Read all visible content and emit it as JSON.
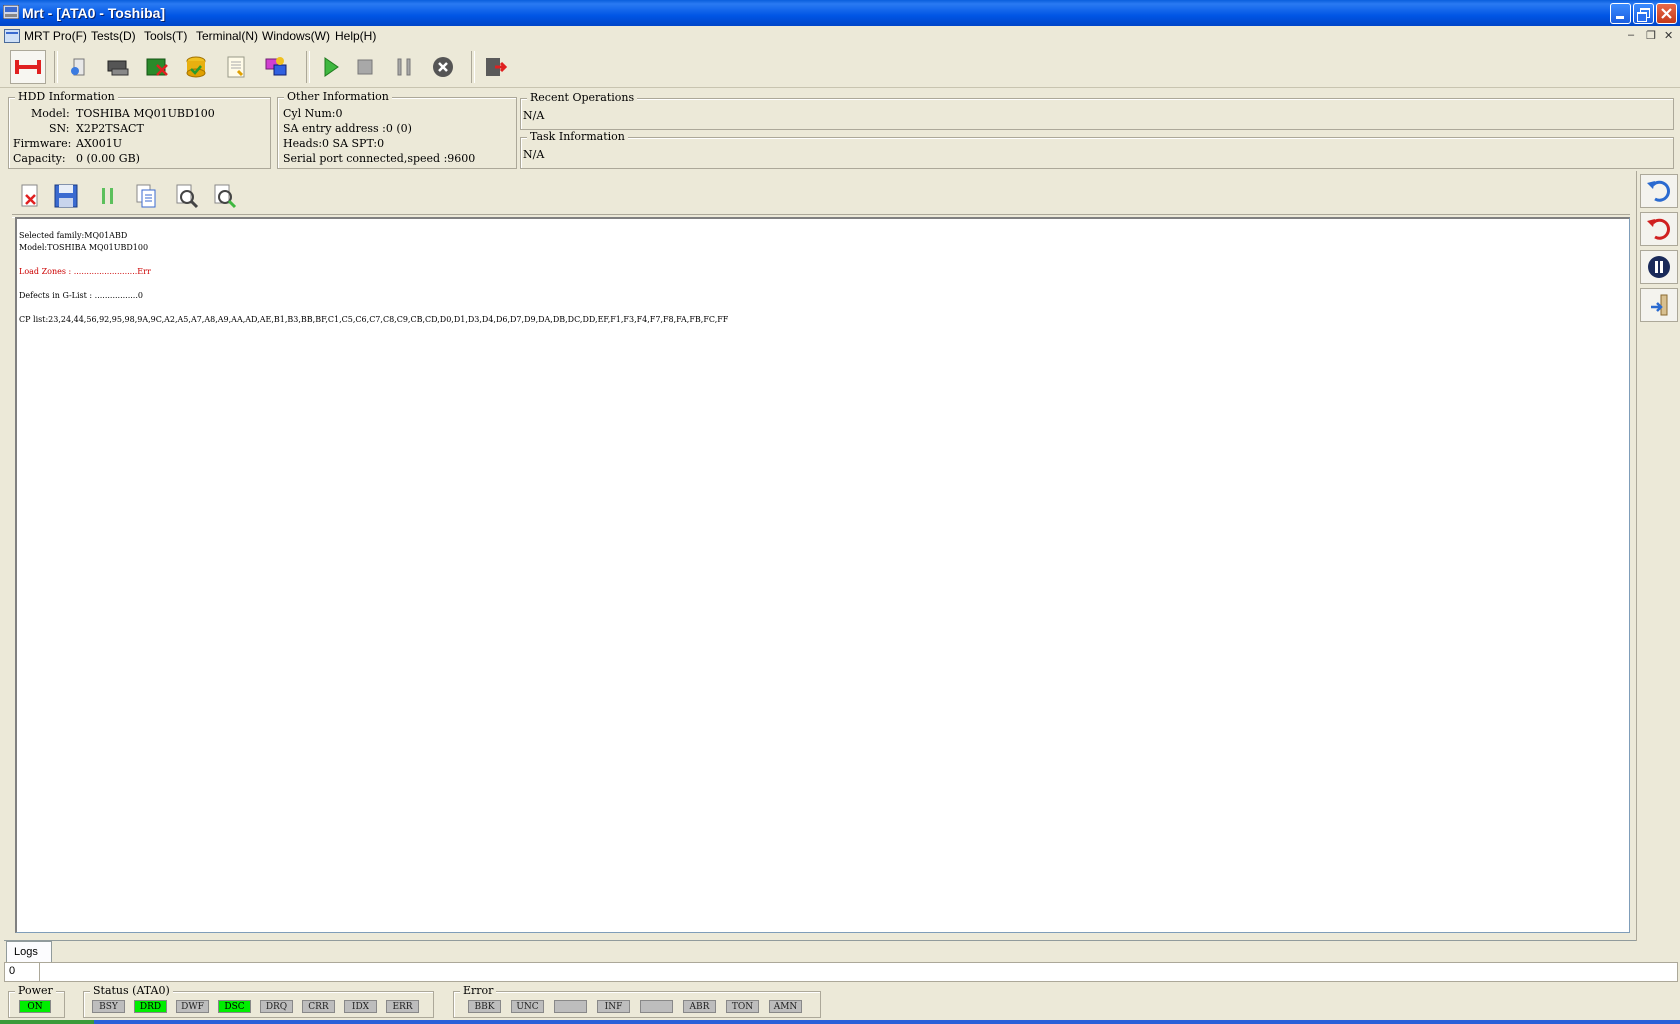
{
  "window": {
    "title": "Mrt - [ATA0 - Toshiba]"
  },
  "menu": {
    "items": [
      "MRT Pro(F)",
      "Tests(D)",
      "Tools(T)",
      "Terminal(N)",
      "Windows(W)",
      "Help(H)"
    ]
  },
  "hdd_info": {
    "legend": "HDD Information",
    "model_label": "Model:",
    "model": "TOSHIBA MQ01UBD100",
    "sn_label": "SN:",
    "sn": "X2P2TSACT",
    "firmware_label": "Firmware:",
    "firmware": "AX001U",
    "capacity_label": "Capacity:",
    "capacity": "0 (0.00 GB)"
  },
  "other_info": {
    "legend": "Other Information",
    "lines": [
      "Cyl Num:0",
      "SA entry address :0 (0)",
      "Heads:0 SA SPT:0",
      "Serial port connected,speed :9600"
    ]
  },
  "recent_ops": {
    "legend": "Recent Operations",
    "value": "N/A"
  },
  "task_info": {
    "legend": "Task Information",
    "value": "N/A"
  },
  "log": {
    "lines": [
      {
        "text": "Selected family:MQ01ABD",
        "color": "#000000"
      },
      {
        "text": "Model:TOSHIBA MQ01UBD100",
        "color": "#000000"
      },
      {
        "text": "",
        "color": "#000000"
      },
      {
        "text": "Load Zones : .........................Err",
        "color": "#cc0000"
      },
      {
        "text": "",
        "color": "#000000"
      },
      {
        "text": "Defects in G-List : .................0",
        "color": "#000000"
      },
      {
        "text": "",
        "color": "#000000"
      },
      {
        "text": "CP list:23,24,44,56,92,95,98,9A,9C,A2,A5,A7,A8,A9,AA,AD,AE,B1,B3,BB,BF,C1,C5,C6,C7,C8,C9,CB,CD,D0,D1,D3,D4,D6,D7,D9,DA,DB,DC,DD,EF,F1,F3,F4,F7,F8,FA,FB,FC,FF",
        "color": "#000000"
      }
    ]
  },
  "tabs": {
    "logs": "Logs"
  },
  "status_strip": {
    "value": "0"
  },
  "power": {
    "legend": "Power",
    "on_label": "ON"
  },
  "status": {
    "legend": "Status (ATA0)",
    "leds": [
      {
        "label": "BSY",
        "on": false
      },
      {
        "label": "DRD",
        "on": true
      },
      {
        "label": "DWF",
        "on": false
      },
      {
        "label": "DSC",
        "on": true
      },
      {
        "label": "DRQ",
        "on": false
      },
      {
        "label": "CRR",
        "on": false
      },
      {
        "label": "IDX",
        "on": false
      },
      {
        "label": "ERR",
        "on": false
      }
    ]
  },
  "error": {
    "legend": "Error",
    "leds": [
      {
        "label": "BBK",
        "on": false
      },
      {
        "label": "UNC",
        "on": false
      },
      {
        "label": "",
        "on": false
      },
      {
        "label": "INF",
        "on": false
      },
      {
        "label": "",
        "on": false
      },
      {
        "label": "ABR",
        "on": false
      },
      {
        "label": "TON",
        "on": false
      },
      {
        "label": "AMN",
        "on": false
      }
    ]
  },
  "colors": {
    "title_bar": "#0055e5",
    "led_on": "#00ee00",
    "led_off": "#bdbdbd",
    "error_text": "#cc0000"
  }
}
